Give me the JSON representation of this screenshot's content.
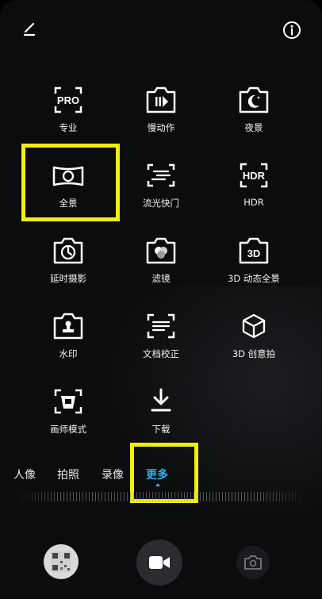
{
  "modes": [
    {
      "label": "专业",
      "icon": "pro-icon"
    },
    {
      "label": "慢动作",
      "icon": "slow-motion-icon"
    },
    {
      "label": "夜景",
      "icon": "night-icon"
    },
    {
      "label": "全景",
      "icon": "panorama-icon"
    },
    {
      "label": "流光快门",
      "icon": "light-trail-icon"
    },
    {
      "label": "HDR",
      "icon": "hdr-icon"
    },
    {
      "label": "延时摄影",
      "icon": "timelapse-icon"
    },
    {
      "label": "滤镜",
      "icon": "filter-icon"
    },
    {
      "label": "3D 动态全景",
      "icon": "3d-panorama-icon"
    },
    {
      "label": "水印",
      "icon": "watermark-icon"
    },
    {
      "label": "文档校正",
      "icon": "document-scan-icon"
    },
    {
      "label": "3D 创意拍",
      "icon": "3d-creative-icon"
    },
    {
      "label": "画师模式",
      "icon": "painter-icon"
    },
    {
      "label": "下载",
      "icon": "download-icon"
    }
  ],
  "icon_text": {
    "pro": "PRO",
    "hdr": "HDR",
    "three_d": "3D"
  },
  "tabs": [
    {
      "label": "人像",
      "active": false
    },
    {
      "label": "拍照",
      "active": false
    },
    {
      "label": "录像",
      "active": false
    },
    {
      "label": "更多",
      "active": true
    }
  ],
  "colors": {
    "accent": "#27b4f5",
    "highlight": "#f5f000",
    "background": "#0b0c0e"
  }
}
